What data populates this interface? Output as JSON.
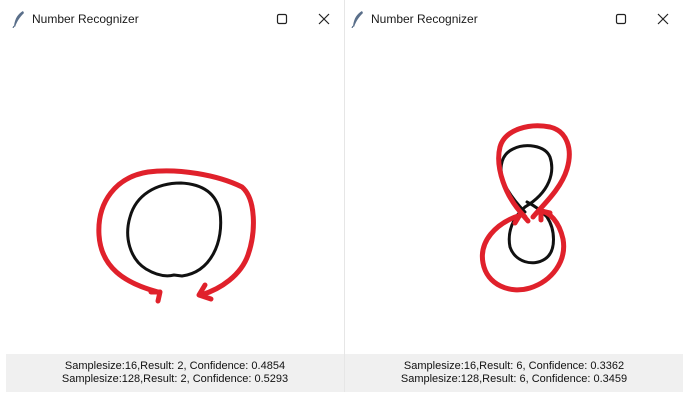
{
  "windows": [
    {
      "title": "Number Recognizer",
      "status": {
        "line1": "Samplesize:16,Result: 2, Confidence: 0.4854",
        "line2": "Samplesize:128,Result: 2, Confidence: 0.5293"
      }
    },
    {
      "title": "Number Recognizer",
      "status": {
        "line1": "Samplesize:16,Result: 6, Confidence: 0.3362",
        "line2": "Samplesize:128,Result: 6, Confidence: 0.3459"
      }
    }
  ],
  "icons": {
    "app": "feather-icon",
    "maximize": "maximize-icon",
    "close": "close-icon"
  },
  "colors": {
    "stroke_user": "#000000",
    "stroke_annotation": "#e0212b",
    "status_bg": "#f0f0f0"
  }
}
